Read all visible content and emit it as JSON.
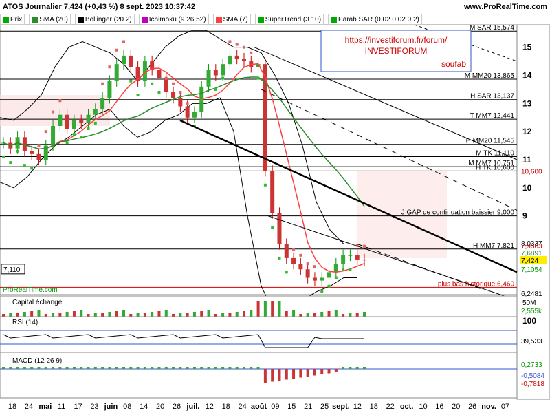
{
  "header": {
    "title": "ATOS Journalier 7,424 (+0,43 %) 8 sept. 2023 10:37:42",
    "brand": "www.ProRealTime.com",
    "watermark": "ProRealTime.com"
  },
  "legend": [
    {
      "label": "Prix",
      "color": "#00aa00"
    },
    {
      "label": "SMA (20)",
      "color": "#2c8c2c"
    },
    {
      "label": "Bollinger (20 2)",
      "color": "#000000"
    },
    {
      "label": "Ichimoku (9 26 52)",
      "color": "#c000c0"
    },
    {
      "label": "SMA (7)",
      "color": "#ff4040"
    },
    {
      "label": "SuperTrend (3 10)",
      "color": "#00aa00"
    },
    {
      "label": "Parab SAR (0.02 0.02 0.2)",
      "color": "#00aa00"
    }
  ],
  "annotation_box": {
    "line1": "https://investiforum.fr/forum/",
    "line2": "INVESTIFORUM",
    "line3": "soufab"
  },
  "chart_data": {
    "type": "line",
    "price_axis": {
      "ticks": [
        "15",
        "14",
        "13",
        "12",
        "11",
        "10",
        "9"
      ],
      "range": [
        6.2,
        15.8
      ]
    },
    "date_axis": {
      "labels": [
        "18",
        "24",
        "mai",
        "11",
        "17",
        "23",
        "juin",
        "08",
        "14",
        "20",
        "26",
        "juil.",
        "12",
        "18",
        "24",
        "août",
        "09",
        "15",
        "21",
        "25",
        "sept.",
        "12",
        "18",
        "22",
        "oct.",
        "10",
        "16",
        "20",
        "26",
        "nov.",
        "07"
      ]
    },
    "horizontal_levels": [
      {
        "label": "M SAR 15,574",
        "value": 15.574
      },
      {
        "label": "M MM20 13,865",
        "value": 13.865
      },
      {
        "label": "H SAR 13,137",
        "value": 13.137
      },
      {
        "label": "T MM7 12,441",
        "value": 12.441
      },
      {
        "label": "H MM20 11,545",
        "value": 11.545
      },
      {
        "label": "M TK 11,110",
        "value": 11.11
      },
      {
        "label": "M MM7 10,751",
        "value": 10.751
      },
      {
        "label": "H TK 10,600",
        "value": 10.6
      },
      {
        "label": "J GAP de continuation baissier 9,000",
        "value": 9.0
      },
      {
        "label": "H MM7 7,821",
        "value": 7.821
      },
      {
        "label": "plus bas historique 6,460",
        "value": 6.46
      }
    ],
    "value_labels": [
      "8,0337",
      "7,9363",
      "7,6891",
      "7,424",
      "7,1054",
      "6,2481",
      "10,600",
      "7,110"
    ],
    "close_series": [
      11.6,
      11.4,
      11.8,
      11.3,
      11.2,
      11.0,
      11.5,
      12.2,
      12.6,
      12.1,
      12.4,
      12.3,
      12.6,
      12.8,
      13.2,
      13.8,
      14.4,
      14.7,
      14.3,
      13.8,
      14.5,
      14.2,
      13.9,
      13.4,
      13.2,
      12.9,
      12.5,
      12.7,
      13.6,
      14.2,
      14.0,
      14.4,
      14.7,
      14.6,
      14.5,
      14.3,
      14.4,
      10.6,
      9.1,
      8.0,
      7.5,
      7.3,
      7.1,
      6.8,
      6.7,
      6.8,
      7.0,
      7.3,
      7.6,
      7.6,
      7.45,
      7.42
    ],
    "capital": {
      "label": "Capital échangé",
      "ticks": [
        "50M",
        "2,555k"
      ]
    },
    "rsi": {
      "label": "RSI (14)",
      "ticks": [
        "100",
        "39,533"
      ]
    },
    "macd": {
      "label": "MACD (12 26 9)",
      "ticks": [
        "0,2733",
        "-0,5084",
        "-0,7818"
      ]
    }
  }
}
